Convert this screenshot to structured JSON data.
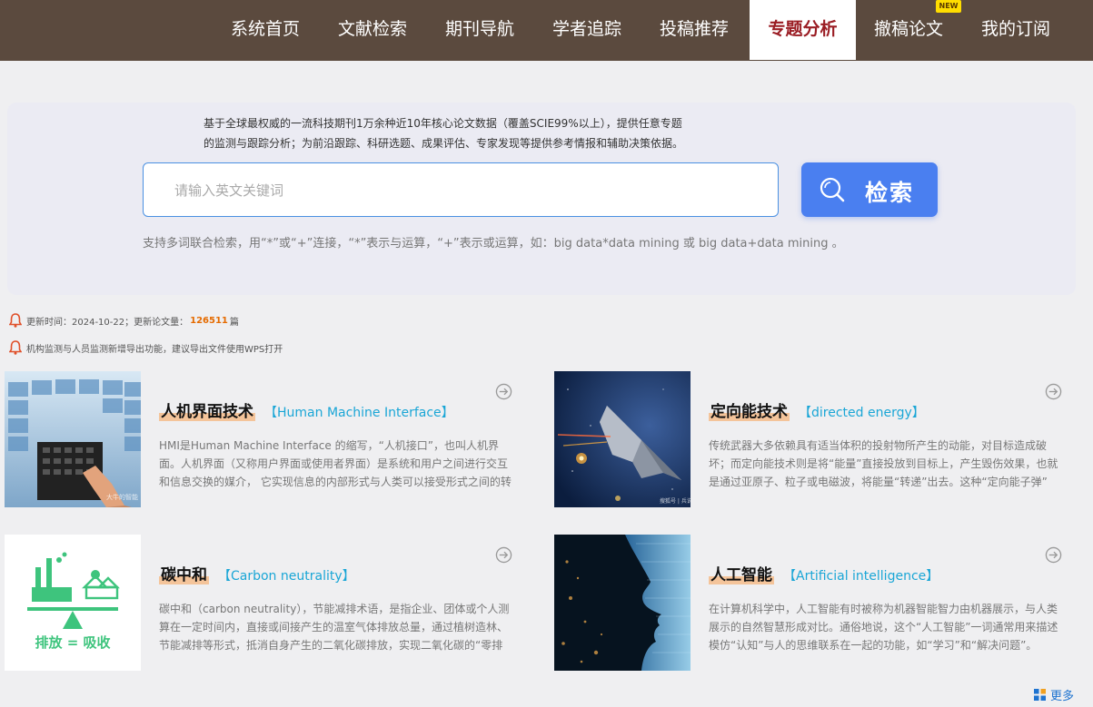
{
  "nav": {
    "items": [
      {
        "label": "系统首页"
      },
      {
        "label": "文献检索"
      },
      {
        "label": "期刊导航"
      },
      {
        "label": "学者追踪"
      },
      {
        "label": "投稿推荐"
      },
      {
        "label": "专题分析",
        "active": true
      },
      {
        "label": "撤稿论文"
      },
      {
        "label": "我的订阅"
      }
    ],
    "new_badge": "NEW"
  },
  "search": {
    "intro_line1": "基于全球最权威的一流科技期刊1万余种近10年核心论文数据（覆盖SCIE99%以上），提供任意专题",
    "intro_line2": "的监测与跟踪分析；为前沿跟踪、科研选题、成果评估、专家发现等提供参考情报和辅助决策依据。",
    "placeholder": "请输入英文关键词",
    "value": "",
    "button_label": "检索",
    "hint": "支持多词联合检索，用“*”或“+”连接，“*”表示与运算，“+”表示或运算，如：big data*data mining 或 big data+data mining 。"
  },
  "notices": {
    "update_prefix": "更新时间：2024-10-22；更新论文量：",
    "update_count": "126511",
    "update_suffix": "篇",
    "export_tip": "机构监测与人员监测新增导出功能，建议导出文件使用WPS打开"
  },
  "topics": [
    {
      "title_zh": "人机界面技术",
      "title_en": "【Human Machine Interface】",
      "desc": "HMI是Human Machine Interface 的缩写，“人机接口”，也叫人机界面。人机界面（又称用户界面或使用者界面）是系统和用户之间进行交互和信息交换的媒介， 它实现信息的内部形式与人类可以接受形式之间的转换。",
      "watermark": "大牛的智能"
    },
    {
      "title_zh": "定向能技术",
      "title_en": "【directed energy】",
      "desc": "传统武器大多依赖具有适当体积的投射物所产生的动能，对目标造成破坏；而定向能技术则是将“能量”直接投放到目标上，产生毁伤效果，也就是通过亚原子、粒子或电磁波，将能量“转递”出去。这种“定向能子弹”",
      "watermark": "搜狐号 | 兵说"
    },
    {
      "title_zh": "碳中和",
      "title_en": "【Carbon neutrality】",
      "desc": "碳中和（carbon neutrality），节能减排术语，是指企业、团体或个人测算在一定时间内，直接或间接产生的温室气体排放总量，通过植树造林、节能减排等形式，抵消自身产生的二氧化碳排放，实现二氧化碳的“零排放”。",
      "image_text": "排放 = 吸收"
    },
    {
      "title_zh": "人工智能",
      "title_en": "【Artificial intelligence】",
      "desc": "在计算机科学中，人工智能有时被称为机器智能智力由机器展示，与人类展示的自然智慧形成对比。通俗地说，这个“人工智能”一词通常用来描述模仿“认知”与人的思维联系在一起的功能，如“学习”和“解决问题”。"
    }
  ],
  "more_label": "更多",
  "colors": {
    "nav_bg": "#5b4a3e",
    "active_nav_text": "#9a1c23",
    "search_button": "#4a7ff0",
    "accent_en": "#1aa6d6",
    "count_highlight": "#e56b00"
  }
}
